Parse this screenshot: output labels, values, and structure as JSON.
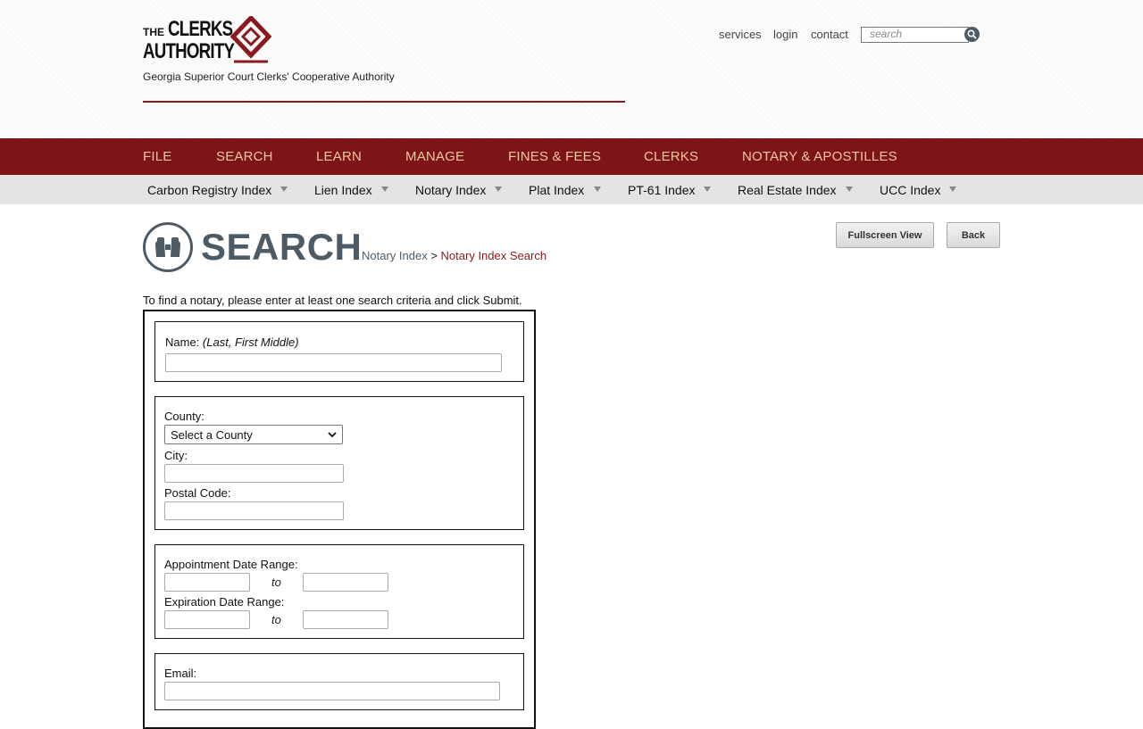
{
  "brand": {
    "logo_line1_small": "THE",
    "logo_line1_big": "CLERKS",
    "logo_line2_big": "AUTHORITY",
    "tagline": "Georgia Superior Court Clerks' Cooperative Authority",
    "accent_color": "#8b1a1f"
  },
  "toplinks": {
    "services": "services",
    "login": "login",
    "contact": "contact"
  },
  "site_search": {
    "placeholder": "search",
    "icon": "search-icon"
  },
  "main_nav": [
    "FILE",
    "SEARCH",
    "LEARN",
    "MANAGE",
    "FINES & FEES",
    "CLERKS",
    "NOTARY & APOSTILLES"
  ],
  "sub_nav": [
    "Carbon Registry Index",
    "Lien Index",
    "Notary Index",
    "Plat Index",
    "PT-61 Index",
    "Real Estate Index",
    "UCC Index"
  ],
  "page": {
    "title": "SEARCH",
    "icon": "binoculars-icon",
    "breadcrumb_parent": "Notary Index",
    "breadcrumb_sep": ">",
    "breadcrumb_current": "Notary Index Search",
    "fullscreen_label": "Fullscreen View",
    "back_label": "Back"
  },
  "form": {
    "instructions": "To find a notary, please enter at least one search criteria and click Submit.",
    "name_label": "Name:",
    "name_hint": "(Last, First Middle)",
    "name_value": "",
    "county_label": "County:",
    "county_selected": "Select a County",
    "city_label": "City:",
    "city_value": "",
    "postal_label": "Postal Code:",
    "postal_value": "",
    "appointment_label": "Appointment Date Range:",
    "expiration_label": "Expiration Date Range:",
    "to_label": "to",
    "email_label": "Email:",
    "email_value": ""
  }
}
